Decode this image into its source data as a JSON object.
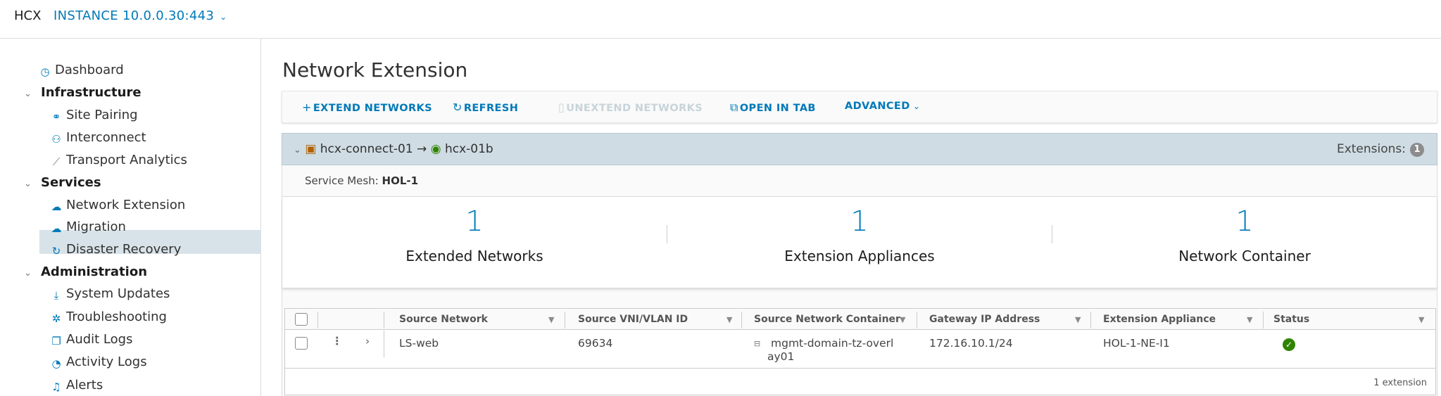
{
  "header": {
    "brand": "HCX",
    "instance": "INSTANCE 10.0.0.30:443",
    "instance_chevron": "⌄"
  },
  "sidebar": {
    "dashboard": "Dashboard",
    "infrastructure": {
      "label": "Infrastructure",
      "items": [
        "Site Pairing",
        "Interconnect",
        "Transport Analytics"
      ]
    },
    "services": {
      "label": "Services",
      "items": [
        "Network Extension",
        "Migration",
        "Disaster Recovery"
      ]
    },
    "administration": {
      "label": "Administration",
      "items": [
        "System Updates",
        "Troubleshooting",
        "Audit Logs",
        "Activity Logs",
        "Alerts"
      ]
    },
    "selected": "Network Extension"
  },
  "main": {
    "title": "Network Extension",
    "toolbar": {
      "extend": "EXTEND NETWORKS",
      "refresh": "REFRESH",
      "unextend": "UNEXTEND NETWORKS",
      "open_in_tab": "OPEN IN TAB",
      "advanced": "ADVANCED"
    },
    "mesh": {
      "source_site": "hcx-connect-01",
      "arrow": "→",
      "dest_site": "hcx-01b",
      "extensions_label": "Extensions:",
      "extensions_count": "1",
      "service_mesh_label": "Service Mesh:",
      "service_mesh_value": "HOL-1"
    },
    "stats": [
      {
        "value": "1",
        "label": "Extended Networks"
      },
      {
        "value": "1",
        "label": "Extension Appliances"
      },
      {
        "value": "1",
        "label": "Network Container"
      }
    ],
    "table": {
      "columns": [
        "Source Network",
        "Source VNI/VLAN ID",
        "Source Network Container",
        "Gateway IP Address",
        "Extension Appliance",
        "Status"
      ],
      "rows": [
        {
          "source_network": "LS-web",
          "vlan": "69634",
          "container_line1": "mgmt-domain-tz-overl",
          "container_line2": "ay01",
          "gateway": "172.16.10.1/24",
          "appliance": "HOL-1-NE-I1",
          "status": "ok"
        }
      ],
      "footer": "1 extension"
    }
  },
  "colors": {
    "accent": "#0079b8",
    "selected_bg": "#d8e3e9",
    "mesh_header": "#cfdce3",
    "status_ok": "#2f8400"
  }
}
